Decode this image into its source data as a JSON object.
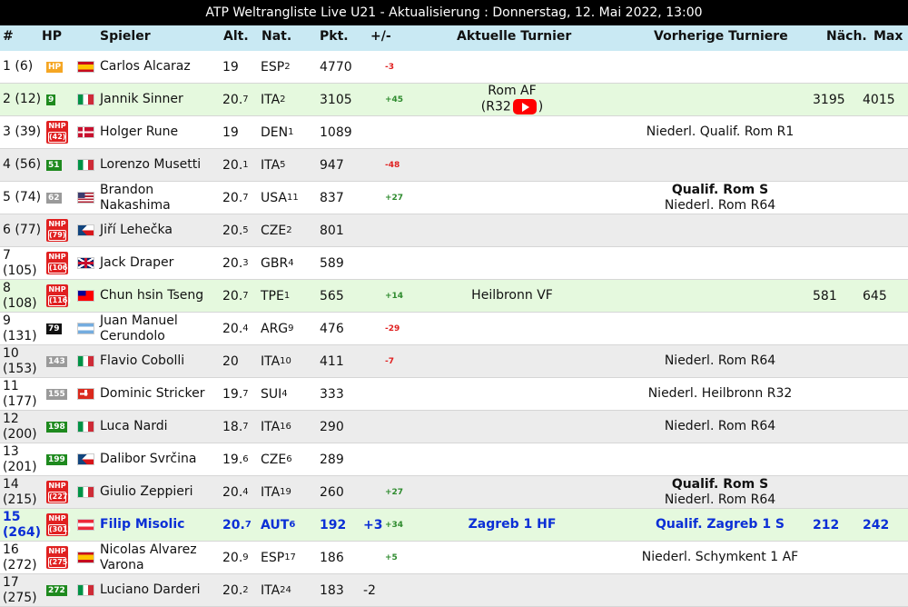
{
  "title": "ATP Weltrangliste Live U21 - Aktualisierung : Donnerstag, 12. Mai 2022, 13:00",
  "headers": {
    "rank": "#",
    "hp": "HP",
    "player": "Spieler",
    "age": "Alt.",
    "nat": "Nat.",
    "pts": "Pkt.",
    "plusminus": "+/-",
    "current": "Aktuelle Turnier",
    "previous": "Vorherige Turniere",
    "next": "Näch.",
    "max": "Max"
  },
  "rows": [
    {
      "rank": "1 (6)",
      "hp": "HP",
      "hp_style": "orange",
      "flag": "ESP",
      "name": "Carlos Alcaraz",
      "age": "19",
      "age_sub": "",
      "nat": "ESP",
      "nat_sub": "2",
      "pts": "4770",
      "plus": "",
      "diff": "-3",
      "cur1": "",
      "cur2": "",
      "prev1": "",
      "prev2": "",
      "next": "",
      "max": "",
      "bg": "even"
    },
    {
      "rank": "2 (12)",
      "hp": "9",
      "hp_style": "green",
      "flag": "ITA",
      "name": "Jannik Sinner",
      "age": "20.",
      "age_sub": "7",
      "nat": "ITA",
      "nat_sub": "2",
      "pts": "3105",
      "plus": "",
      "diff": "+45",
      "cur1": "Rom AF",
      "cur2": "(R32",
      "cur2b": ")",
      "yt": true,
      "prev1": "",
      "prev2": "",
      "next": "3195",
      "max": "4015",
      "bg": "green"
    },
    {
      "rank": "3 (39)",
      "hp": "NHP",
      "hp_inner": "(42)",
      "hp_style": "red",
      "flag": "DEN",
      "name": "Holger Rune",
      "age": "19",
      "age_sub": "",
      "nat": "DEN",
      "nat_sub": "1",
      "pts": "1089",
      "plus": "",
      "diff": "",
      "cur1": "",
      "cur2": "",
      "prev1": "Niederl. Qualif. Rom R1",
      "prev2": "",
      "next": "",
      "max": "",
      "bg": "even"
    },
    {
      "rank": "4 (56)",
      "hp": "51",
      "hp_style": "green",
      "flag": "ITA",
      "name": "Lorenzo Musetti",
      "age": "20.",
      "age_sub": "1",
      "nat": "ITA",
      "nat_sub": "5",
      "pts": "947",
      "plus": "",
      "diff": "-48",
      "cur1": "",
      "cur2": "",
      "prev1": "",
      "prev2": "",
      "next": "",
      "max": "",
      "bg": "odd"
    },
    {
      "rank": "5 (74)",
      "hp": "62",
      "hp_style": "grey",
      "flag": "USA",
      "name": "Brandon Nakashima",
      "age": "20.",
      "age_sub": "7",
      "nat": "USA",
      "nat_sub": "11",
      "pts": "837",
      "plus": "",
      "diff": "+27",
      "cur1": "",
      "cur2": "",
      "prev1": "Qualif. Rom S",
      "prev1_bold": true,
      "prev2": "Niederl. Rom R64",
      "next": "",
      "max": "",
      "bg": "even"
    },
    {
      "rank": "6 (77)",
      "hp": "NHP",
      "hp_inner": "(79)",
      "hp_style": "red",
      "flag": "CZE",
      "name": "Jiří Lehečka",
      "age": "20.",
      "age_sub": "5",
      "nat": "CZE",
      "nat_sub": "2",
      "pts": "801",
      "plus": "",
      "diff": "",
      "cur1": "",
      "cur2": "",
      "prev1": "",
      "prev2": "",
      "next": "",
      "max": "",
      "bg": "odd"
    },
    {
      "rank": "7 (105)",
      "hp": "NHP",
      "hp_inner": "(106)",
      "hp_style": "red",
      "flag": "GBR",
      "name": "Jack Draper",
      "age": "20.",
      "age_sub": "3",
      "nat": "GBR",
      "nat_sub": "4",
      "pts": "589",
      "plus": "",
      "diff": "",
      "cur1": "",
      "cur2": "",
      "prev1": "",
      "prev2": "",
      "next": "",
      "max": "",
      "bg": "even"
    },
    {
      "rank": "8 (108)",
      "hp": "NHP",
      "hp_inner": "(116)",
      "hp_style": "red",
      "flag": "TPE",
      "name": "Chun hsin Tseng",
      "age": "20.",
      "age_sub": "7",
      "nat": "TPE",
      "nat_sub": "1",
      "pts": "565",
      "plus": "",
      "diff": "+14",
      "cur1": "Heilbronn VF",
      "cur2": "",
      "prev1": "",
      "prev2": "",
      "next": "581",
      "max": "645",
      "bg": "green"
    },
    {
      "rank": "9 (131)",
      "hp": "79",
      "hp_style": "black",
      "flag": "ARG",
      "name": "Juan Manuel Cerundolo",
      "age": "20.",
      "age_sub": "4",
      "nat": "ARG",
      "nat_sub": "9",
      "pts": "476",
      "plus": "",
      "diff": "-29",
      "cur1": "",
      "cur2": "",
      "prev1": "",
      "prev2": "",
      "next": "",
      "max": "",
      "bg": "even"
    },
    {
      "rank": "10 (153)",
      "hp": "143",
      "hp_style": "grey",
      "flag": "ITA",
      "name": "Flavio Cobolli",
      "age": "20",
      "age_sub": "",
      "nat": "ITA",
      "nat_sub": "10",
      "pts": "411",
      "plus": "",
      "diff": "-7",
      "cur1": "",
      "cur2": "",
      "prev1": "Niederl. Rom R64",
      "prev2": "",
      "next": "",
      "max": "",
      "bg": "odd"
    },
    {
      "rank": "11 (177)",
      "hp": "155",
      "hp_style": "grey",
      "flag": "SUI",
      "name": "Dominic Stricker",
      "age": "19.",
      "age_sub": "7",
      "nat": "SUI",
      "nat_sub": "4",
      "pts": "333",
      "plus": "",
      "diff": "",
      "cur1": "",
      "cur2": "",
      "prev1": "Niederl. Heilbronn R32",
      "prev2": "",
      "next": "",
      "max": "",
      "bg": "even"
    },
    {
      "rank": "12 (200)",
      "hp": "198",
      "hp_style": "green",
      "flag": "ITA",
      "name": "Luca Nardi",
      "age": "18.",
      "age_sub": "7",
      "nat": "ITA",
      "nat_sub": "16",
      "pts": "290",
      "plus": "",
      "diff": "",
      "cur1": "",
      "cur2": "",
      "prev1": "Niederl. Rom R64",
      "prev2": "",
      "next": "",
      "max": "",
      "bg": "odd"
    },
    {
      "rank": "13 (201)",
      "hp": "199",
      "hp_style": "green",
      "flag": "CZE",
      "name": "Dalibor Svrčina",
      "age": "19.",
      "age_sub": "6",
      "nat": "CZE",
      "nat_sub": "6",
      "pts": "289",
      "plus": "",
      "diff": "",
      "cur1": "",
      "cur2": "",
      "prev1": "",
      "prev2": "",
      "next": "",
      "max": "",
      "bg": "even"
    },
    {
      "rank": "14 (215)",
      "hp": "NHP",
      "hp_inner": "(227)",
      "hp_style": "red",
      "flag": "ITA",
      "name": "Giulio Zeppieri",
      "age": "20.",
      "age_sub": "4",
      "nat": "ITA",
      "nat_sub": "19",
      "pts": "260",
      "plus": "",
      "diff": "+27",
      "cur1": "",
      "cur2": "",
      "prev1": "Qualif. Rom S",
      "prev1_bold": true,
      "prev2": "Niederl. Rom R64",
      "next": "",
      "max": "",
      "bg": "odd"
    },
    {
      "rank": "15 (264)",
      "hp": "NHP",
      "hp_inner": "(301)",
      "hp_style": "red",
      "flag": "AUT",
      "name": "Filip Misolic",
      "age": "20.",
      "age_sub": "7",
      "nat": "AUT",
      "nat_sub": "6",
      "pts": "192",
      "plus": "+3",
      "diff": "+34",
      "cur1": "Zagreb 1 HF",
      "cur2": "",
      "prev1": "Qualif. Zagreb 1 S",
      "prev2": "",
      "next": "212",
      "max": "242",
      "bg": "green",
      "highlight": true
    },
    {
      "rank": "16 (272)",
      "hp": "NHP",
      "hp_inner": "(275)",
      "hp_style": "red",
      "flag": "ESP",
      "name": "Nicolas Alvarez Varona",
      "age": "20.",
      "age_sub": "9",
      "nat": "ESP",
      "nat_sub": "17",
      "pts": "186",
      "plus": "",
      "diff": "+5",
      "cur1": "",
      "cur2": "",
      "prev1": "Niederl. Schymkent 1 AF",
      "prev2": "",
      "next": "",
      "max": "",
      "bg": "even"
    },
    {
      "rank": "17 (275)",
      "hp": "272",
      "hp_style": "green",
      "flag": "ITA",
      "name": "Luciano Darderi",
      "age": "20.",
      "age_sub": "2",
      "nat": "ITA",
      "nat_sub": "24",
      "pts": "183",
      "plus": "-2",
      "diff": "",
      "cur1": "",
      "cur2": "",
      "prev1": "",
      "prev2": "",
      "next": "",
      "max": "",
      "bg": "odd"
    }
  ]
}
